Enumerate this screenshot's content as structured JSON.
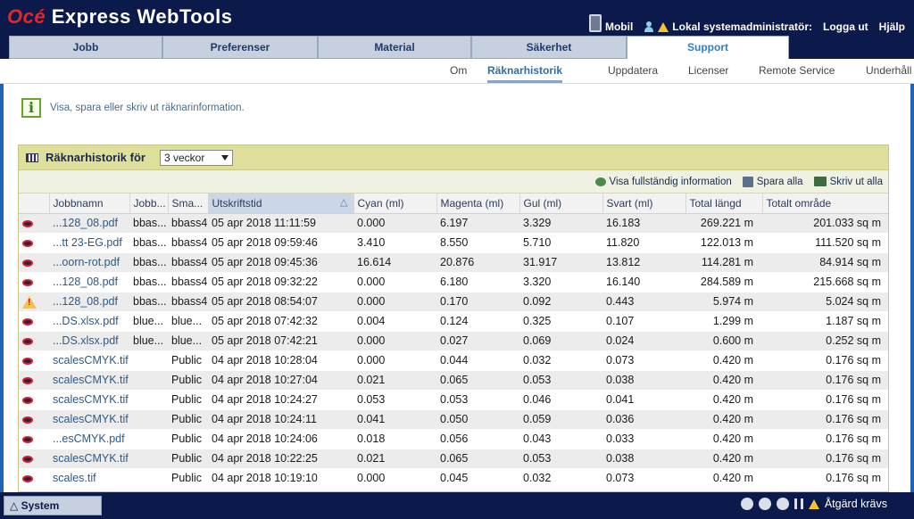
{
  "brand": {
    "logo": "Océ",
    "title": "Express WebTools"
  },
  "toplinks": {
    "mobile": "Mobil",
    "user": "Lokal systemadministratör:",
    "logout": "Logga ut",
    "help": "Hjälp"
  },
  "main_tabs": [
    "Jobb",
    "Preferenser",
    "Material",
    "Säkerhet",
    "Support"
  ],
  "sub_tabs": [
    "Om",
    "Räknarhistorik",
    "Uppdatera",
    "Licenser",
    "Remote Service",
    "Underhåll"
  ],
  "info_text": "Visa, spara eller skriv ut räknarinformation.",
  "panel": {
    "title": "Räknarhistorik för",
    "period": "3 veckor",
    "actions": {
      "show_full": "Visa fullständig information",
      "save_all": "Spara alla",
      "print_all": "Skriv ut alla"
    }
  },
  "columns": [
    "Jobbnamn",
    "Jobb...",
    "Sma...",
    "Utskriftstid",
    "Cyan (ml)",
    "Magenta (ml)",
    "Gul (ml)",
    "Svart (ml)",
    "Total längd",
    "Totalt område"
  ],
  "rows": [
    {
      "icon": "eye",
      "name": "...128_08.pdf",
      "owner": "bbas...",
      "small": "bbass4",
      "time": "05 apr 2018 11:11:59",
      "cyan": "0.000",
      "magenta": "6.197",
      "yellow": "3.329",
      "black": "16.183",
      "length": "269.221 m",
      "area": "201.033 sq m"
    },
    {
      "icon": "eye",
      "name": "...tt 23-EG.pdf",
      "owner": "bbas...",
      "small": "bbass4",
      "time": "05 apr 2018 09:59:46",
      "cyan": "3.410",
      "magenta": "8.550",
      "yellow": "5.710",
      "black": "11.820",
      "length": "122.013 m",
      "area": "111.520 sq m"
    },
    {
      "icon": "eye",
      "name": "...oorn-rot.pdf",
      "owner": "bbas...",
      "small": "bbass4",
      "time": "05 apr 2018 09:45:36",
      "cyan": "16.614",
      "magenta": "20.876",
      "yellow": "31.917",
      "black": "13.812",
      "length": "114.281 m",
      "area": "84.914 sq m"
    },
    {
      "icon": "eye",
      "name": "...128_08.pdf",
      "owner": "bbas...",
      "small": "bbass4",
      "time": "05 apr 2018 09:32:22",
      "cyan": "0.000",
      "magenta": "6.180",
      "yellow": "3.320",
      "black": "16.140",
      "length": "284.589 m",
      "area": "215.668 sq m"
    },
    {
      "icon": "warning",
      "name": "...128_08.pdf",
      "owner": "bbas...",
      "small": "bbass4",
      "time": "05 apr 2018 08:54:07",
      "cyan": "0.000",
      "magenta": "0.170",
      "yellow": "0.092",
      "black": "0.443",
      "length": "5.974 m",
      "area": "5.024 sq m"
    },
    {
      "icon": "eye",
      "name": "...DS.xlsx.pdf",
      "owner": "blue...",
      "small": "blue...",
      "time": "05 apr 2018 07:42:32",
      "cyan": "0.004",
      "magenta": "0.124",
      "yellow": "0.325",
      "black": "0.107",
      "length": "1.299 m",
      "area": "1.187 sq m"
    },
    {
      "icon": "eye",
      "name": "...DS.xlsx.pdf",
      "owner": "blue...",
      "small": "blue...",
      "time": "05 apr 2018 07:42:21",
      "cyan": "0.000",
      "magenta": "0.027",
      "yellow": "0.069",
      "black": "0.024",
      "length": "0.600 m",
      "area": "0.252 sq m"
    },
    {
      "icon": "eye",
      "name": "scalesCMYK.tif",
      "owner": "",
      "small": "Public",
      "time": "04 apr 2018 10:28:04",
      "cyan": "0.000",
      "magenta": "0.044",
      "yellow": "0.032",
      "black": "0.073",
      "length": "0.420 m",
      "area": "0.176 sq m"
    },
    {
      "icon": "eye",
      "name": "scalesCMYK.tif",
      "owner": "",
      "small": "Public",
      "time": "04 apr 2018 10:27:04",
      "cyan": "0.021",
      "magenta": "0.065",
      "yellow": "0.053",
      "black": "0.038",
      "length": "0.420 m",
      "area": "0.176 sq m"
    },
    {
      "icon": "eye",
      "name": "scalesCMYK.tif",
      "owner": "",
      "small": "Public",
      "time": "04 apr 2018 10:24:27",
      "cyan": "0.053",
      "magenta": "0.053",
      "yellow": "0.046",
      "black": "0.041",
      "length": "0.420 m",
      "area": "0.176 sq m"
    },
    {
      "icon": "eye",
      "name": "scalesCMYK.tif",
      "owner": "",
      "small": "Public",
      "time": "04 apr 2018 10:24:11",
      "cyan": "0.041",
      "magenta": "0.050",
      "yellow": "0.059",
      "black": "0.036",
      "length": "0.420 m",
      "area": "0.176 sq m"
    },
    {
      "icon": "eye",
      "name": "...esCMYK.pdf",
      "owner": "",
      "small": "Public",
      "time": "04 apr 2018 10:24:06",
      "cyan": "0.018",
      "magenta": "0.056",
      "yellow": "0.043",
      "black": "0.033",
      "length": "0.420 m",
      "area": "0.176 sq m"
    },
    {
      "icon": "eye",
      "name": "scalesCMYK.tif",
      "owner": "",
      "small": "Public",
      "time": "04 apr 2018 10:22:25",
      "cyan": "0.021",
      "magenta": "0.065",
      "yellow": "0.053",
      "black": "0.038",
      "length": "0.420 m",
      "area": "0.176 sq m"
    },
    {
      "icon": "eye",
      "name": "scales.tif",
      "owner": "",
      "small": "Public",
      "time": "04 apr 2018 10:19:10",
      "cyan": "0.000",
      "magenta": "0.045",
      "yellow": "0.032",
      "black": "0.073",
      "length": "0.420 m",
      "area": "0.176 sq m"
    }
  ],
  "status": {
    "system_tab": "System",
    "action_required": "Åtgärd krävs"
  }
}
